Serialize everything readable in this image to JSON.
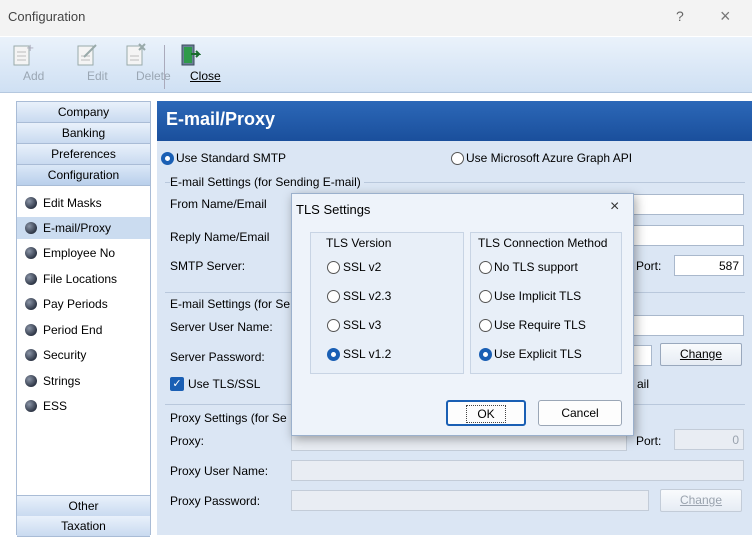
{
  "window": {
    "title": "Configuration",
    "help": "?",
    "close": "×"
  },
  "toolbar": {
    "add": "Add",
    "edit": "Edit",
    "delete": "Delete",
    "close": "Close"
  },
  "sidebar": {
    "top_headers": [
      "Company",
      "Banking",
      "Preferences",
      "Configuration"
    ],
    "items": [
      "Edit Masks",
      "E-mail/Proxy",
      "Employee No",
      "File Locations",
      "Pay Periods",
      "Period End",
      "Security",
      "Strings",
      "ESS"
    ],
    "bottom_headers": [
      "Other",
      "Taxation"
    ]
  },
  "main": {
    "header": "E-mail/Proxy",
    "radio_smtp": "Use Standard SMTP",
    "radio_azure": "Use Microsoft Azure Graph API",
    "email_settings_title": "E-mail Settings (for Sending E-mail)",
    "from_name_label": "From Name/Email",
    "reply_name_label": "Reply Name/Email",
    "smtp_server_label": "SMTP Server:",
    "port_label": "Port:",
    "port_value": "587",
    "email_settings2_title": "E-mail Settings (for Se",
    "server_user_label": "Server User Name:",
    "server_password_label": "Server Password:",
    "change_label": "Change",
    "use_tls_label": "Use TLS/SSL",
    "ail_fragment": "ail",
    "proxy_title": "Proxy Settings (for Se",
    "proxy_label": "Proxy:",
    "proxy_port_label": "Port:",
    "proxy_port_value": "0",
    "proxy_user_label": "Proxy User Name:",
    "proxy_password_label": "Proxy Password:",
    "proxy_change_label": "Change"
  },
  "dialog": {
    "title": "TLS Settings",
    "close": "×",
    "version_title": "TLS Version",
    "versions": [
      "SSL v2",
      "SSL v2.3",
      "SSL v3",
      "SSL v1.2"
    ],
    "method_title": "TLS Connection Method",
    "methods": [
      "No TLS support",
      "Use Implicit TLS",
      "Use Require TLS",
      "Use Explicit TLS"
    ],
    "ok": "OK",
    "cancel": "Cancel"
  }
}
